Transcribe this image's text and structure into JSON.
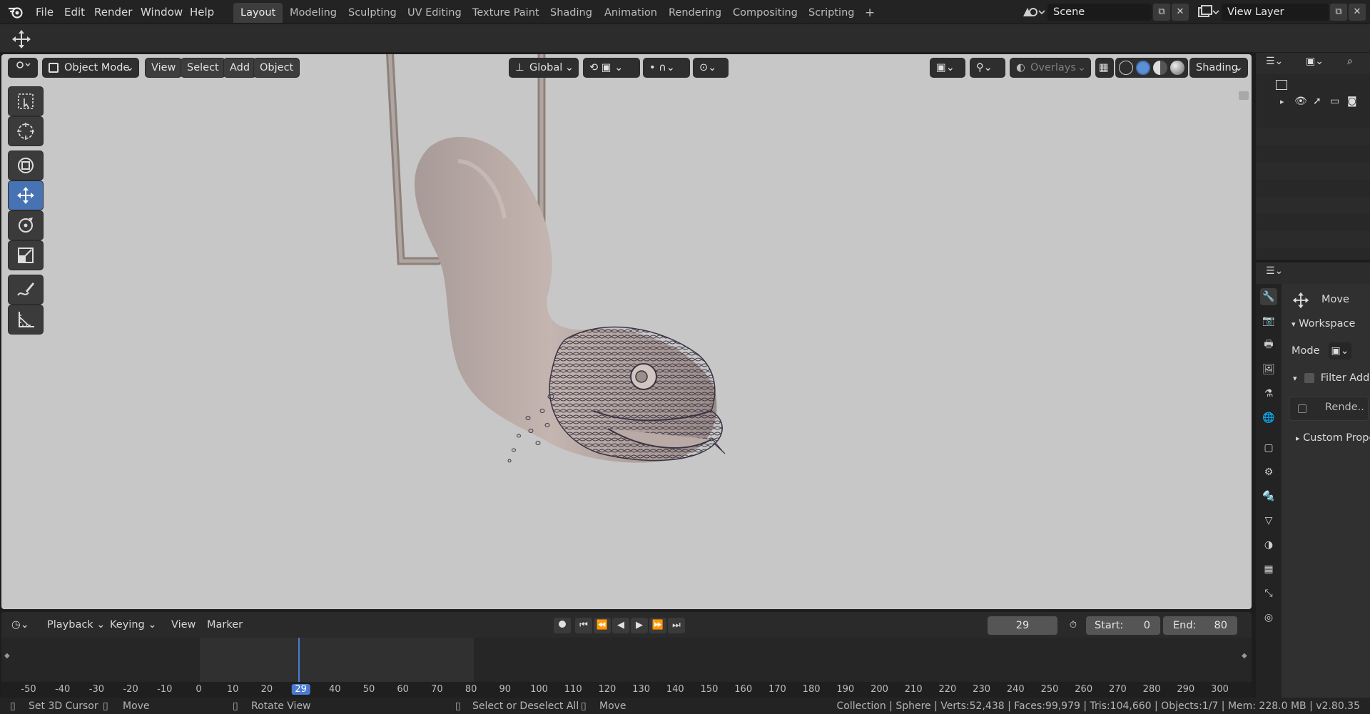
{
  "menubar": {
    "items": [
      "File",
      "Edit",
      "Render",
      "Window",
      "Help"
    ],
    "workspaces": [
      "Layout",
      "Modeling",
      "Sculpting",
      "UV Editing",
      "Texture Paint",
      "Shading",
      "Animation",
      "Rendering",
      "Compositing",
      "Scripting"
    ],
    "active_workspace": "Layout",
    "add_tab": "+",
    "scene_name": "Scene",
    "view_layer": "View Layer"
  },
  "viewport": {
    "mode": "Object Mode",
    "menus": [
      "View",
      "Select",
      "Add",
      "Object"
    ],
    "orientation": "Global",
    "overlays_label": "Overlays",
    "shading_label": "Shading"
  },
  "toolbar": {
    "tools": [
      "select-box-tool",
      "cursor-tool",
      "transform-tool",
      "move-tool",
      "rotate-tool",
      "scale-tool",
      "annotate-tool",
      "measure-tool"
    ],
    "active_tool": "move-tool"
  },
  "timeline": {
    "menus": [
      "Playback",
      "Keying",
      "View",
      "Marker"
    ],
    "current_frame": "29",
    "start_label": "Start:",
    "start_value": "0",
    "end_label": "End:",
    "end_value": "80",
    "ruler": [
      "-50",
      "-40",
      "-30",
      "-20",
      "-10",
      "0",
      "10",
      "20",
      "29",
      "40",
      "50",
      "60",
      "70",
      "80",
      "90",
      "100",
      "110",
      "120",
      "130",
      "140",
      "150",
      "160",
      "170",
      "180",
      "190",
      "200",
      "210",
      "220",
      "230",
      "240",
      "250",
      "260",
      "270",
      "280",
      "290",
      "300"
    ]
  },
  "properties": {
    "tool_name": "Move",
    "workspace_panel": "Workspace",
    "mode_label": "Mode",
    "filter_addons": "Filter Add-",
    "render_label": "Rende..",
    "custom_props": "Custom Prope"
  },
  "statusbar": {
    "set_cursor": "Set 3D Cursor",
    "move": "Move",
    "rotate_view": "Rotate View",
    "select_deselect": "Select or Deselect All",
    "move2": "Move",
    "stats": "Collection | Sphere | Verts:52,438 | Faces:99,979 | Tris:104,660 | Objects:1/7 | Mem: 228.0 MB | v2.80.35"
  }
}
